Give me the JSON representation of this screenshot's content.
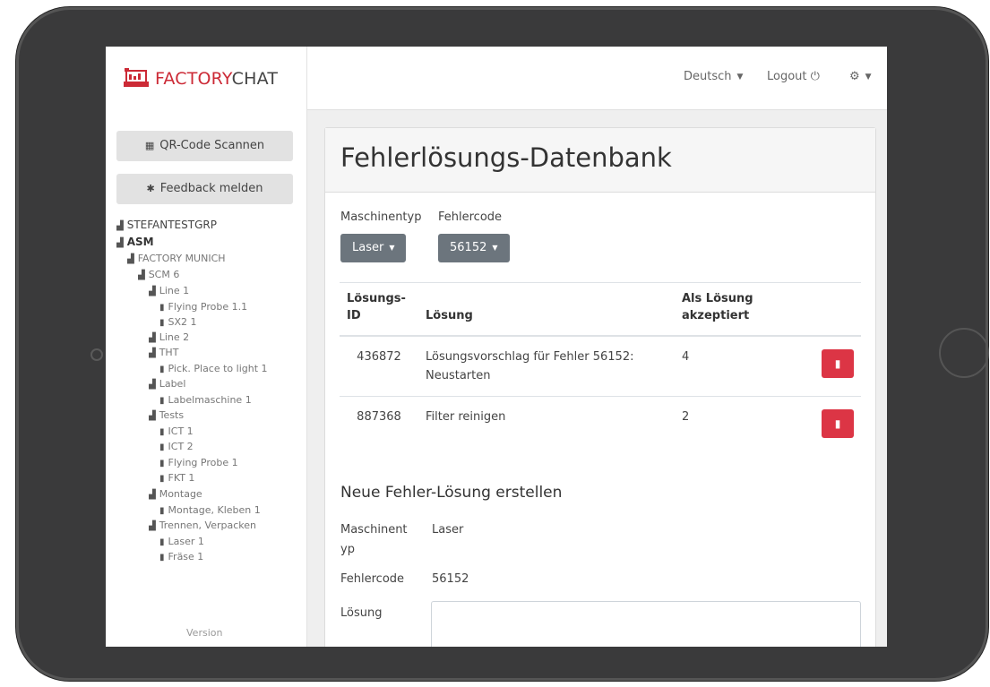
{
  "brand": {
    "part1": "FACTORY",
    "part2": "CHAT",
    "accent": "#cc2a36"
  },
  "nav": {
    "language": "Deutsch",
    "logout": "Logout",
    "settings_icon": "gear-icon"
  },
  "sidebar": {
    "qr_button": "QR-Code Scannen",
    "feedback_button": "Feedback melden",
    "tree": [
      {
        "label": "STEFANTESTGRP"
      },
      {
        "label": "ASM"
      },
      {
        "label": "FACTORY MUNICH"
      },
      {
        "label": "SCM 6"
      },
      {
        "label": "Line 1"
      },
      {
        "label": "Flying Probe 1.1"
      },
      {
        "label": "SX2 1"
      },
      {
        "label": "Line 2"
      },
      {
        "label": "THT"
      },
      {
        "label": "Pick. Place to light 1"
      },
      {
        "label": "Label"
      },
      {
        "label": "Labelmaschine 1"
      },
      {
        "label": "Tests"
      },
      {
        "label": "ICT 1"
      },
      {
        "label": "ICT 2"
      },
      {
        "label": "Flying Probe 1"
      },
      {
        "label": "FKT 1"
      },
      {
        "label": "Montage"
      },
      {
        "label": "Montage, Kleben 1"
      },
      {
        "label": "Trennen, Verpacken"
      },
      {
        "label": "Laser 1"
      },
      {
        "label": "Fräse 1"
      }
    ],
    "version": "Version"
  },
  "main": {
    "title": "Fehlerlösungs-Datenbank",
    "filter": {
      "machine_type_label": "Maschinentyp",
      "machine_type_value": "Laser",
      "error_code_label": "Fehlercode",
      "error_code_value": "56152"
    },
    "table": {
      "headers": {
        "id_1": "Lösungs-",
        "id_2": "ID",
        "solution": "Lösung",
        "accepted_1": "Als Lösung",
        "accepted_2": "akzeptiert"
      },
      "rows": [
        {
          "id": "436872",
          "solution_1": "Lösungsvorschlag für Fehler 56152:",
          "solution_2": "Neustarten",
          "accepted": "4"
        },
        {
          "id": "887368",
          "solution_1": "Filter reinigen",
          "solution_2": "",
          "accepted": "2"
        }
      ],
      "delete_color": "#dc3545"
    },
    "new_form": {
      "title": "Neue Fehler-Lösung erstellen",
      "machine_type_label_1": "Maschinent",
      "machine_type_label_2": "yp",
      "machine_type_value": "Laser",
      "error_code_label": "Fehlercode",
      "error_code_value": "56152",
      "solution_label": "Lösung"
    }
  }
}
